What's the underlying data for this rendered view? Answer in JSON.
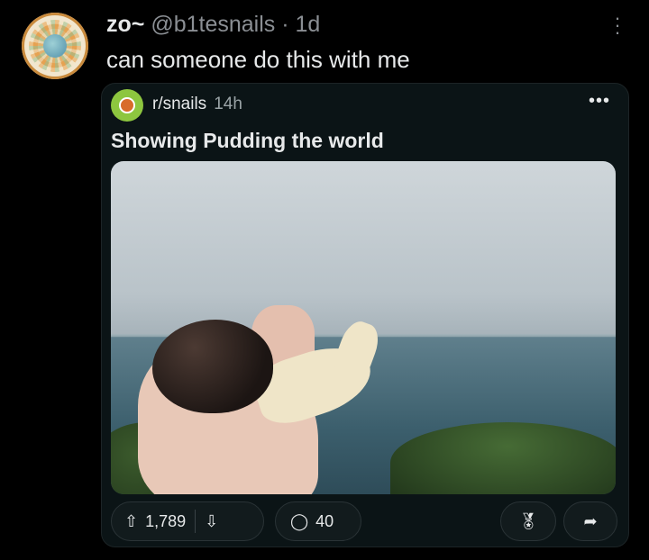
{
  "tweet": {
    "author_name": "zo",
    "author_handle": "@b1tesnails",
    "separator": " · ",
    "time": "1d",
    "text": "can someone do this with me"
  },
  "embed": {
    "subreddit": "r/snails",
    "time": "14h",
    "title": "Showing Pudding the world",
    "upvotes": "1,789",
    "comments": "40"
  },
  "icons": {
    "kebab": "more-vertical-icon",
    "card_more": "more-horizontal-icon",
    "upvote": "arrow-up-icon",
    "downvote": "arrow-down-icon",
    "comment": "comment-bubble-icon",
    "award": "award-icon",
    "share": "share-icon"
  },
  "colors": {
    "background": "#000000",
    "card": "#0b1416",
    "handle_gray": "#8b8f94",
    "subreddit_icon": "#8dc63f"
  }
}
